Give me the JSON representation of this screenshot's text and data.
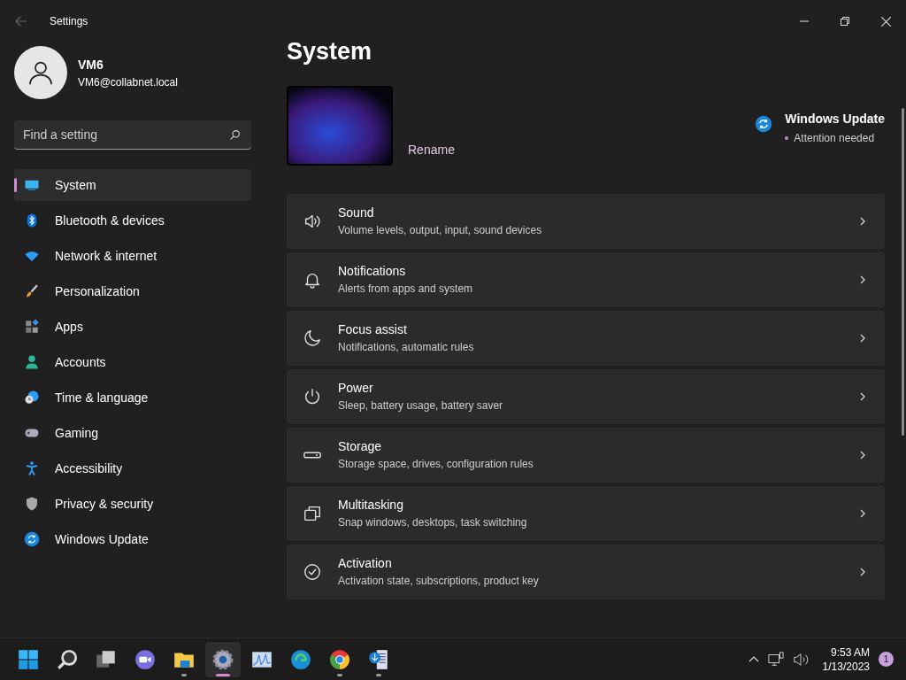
{
  "window": {
    "title": "Settings"
  },
  "account": {
    "name": "VM6",
    "email": "VM6@collabnet.local"
  },
  "search": {
    "placeholder": "Find a setting"
  },
  "nav": [
    {
      "kind": "system",
      "label": "System",
      "selected": true
    },
    {
      "kind": "bluetooth",
      "label": "Bluetooth & devices",
      "selected": false
    },
    {
      "kind": "network",
      "label": "Network & internet",
      "selected": false
    },
    {
      "kind": "brush",
      "label": "Personalization",
      "selected": false
    },
    {
      "kind": "apps",
      "label": "Apps",
      "selected": false
    },
    {
      "kind": "accounts",
      "label": "Accounts",
      "selected": false
    },
    {
      "kind": "time",
      "label": "Time & language",
      "selected": false
    },
    {
      "kind": "gaming",
      "label": "Gaming",
      "selected": false
    },
    {
      "kind": "accessibility",
      "label": "Accessibility",
      "selected": false
    },
    {
      "kind": "shield",
      "label": "Privacy & security",
      "selected": false
    },
    {
      "kind": "update",
      "label": "Windows Update",
      "selected": false
    }
  ],
  "page": {
    "title": "System",
    "rename": "Rename",
    "update": {
      "title": "Windows Update",
      "status": "Attention needed"
    }
  },
  "cards": [
    {
      "kind": "sound",
      "title": "Sound",
      "subtitle": "Volume levels, output, input, sound devices"
    },
    {
      "kind": "bell",
      "title": "Notifications",
      "subtitle": "Alerts from apps and system"
    },
    {
      "kind": "moon",
      "title": "Focus assist",
      "subtitle": "Notifications, automatic rules"
    },
    {
      "kind": "power",
      "title": "Power",
      "subtitle": "Sleep, battery usage, battery saver"
    },
    {
      "kind": "storage",
      "title": "Storage",
      "subtitle": "Storage space, drives, configuration rules"
    },
    {
      "kind": "multitask",
      "title": "Multitasking",
      "subtitle": "Snap windows, desktops, task switching"
    },
    {
      "kind": "check",
      "title": "Activation",
      "subtitle": "Activation state, subscriptions, product key"
    }
  ],
  "taskbar": {
    "apps": [
      {
        "kind": "start",
        "running": false,
        "selected": false
      },
      {
        "kind": "search",
        "running": false,
        "selected": false
      },
      {
        "kind": "taskview",
        "running": false,
        "selected": false
      },
      {
        "kind": "chat",
        "running": false,
        "selected": false
      },
      {
        "kind": "explorer",
        "running": true,
        "selected": false
      },
      {
        "kind": "settings",
        "running": true,
        "selected": true
      },
      {
        "kind": "monitor",
        "running": false,
        "selected": false
      },
      {
        "kind": "edge",
        "running": false,
        "selected": false
      },
      {
        "kind": "chrome",
        "running": true,
        "selected": false
      },
      {
        "kind": "installer",
        "running": true,
        "selected": false
      }
    ],
    "time": "9:53 AM",
    "date": "1/13/2023",
    "notifications": "1"
  }
}
